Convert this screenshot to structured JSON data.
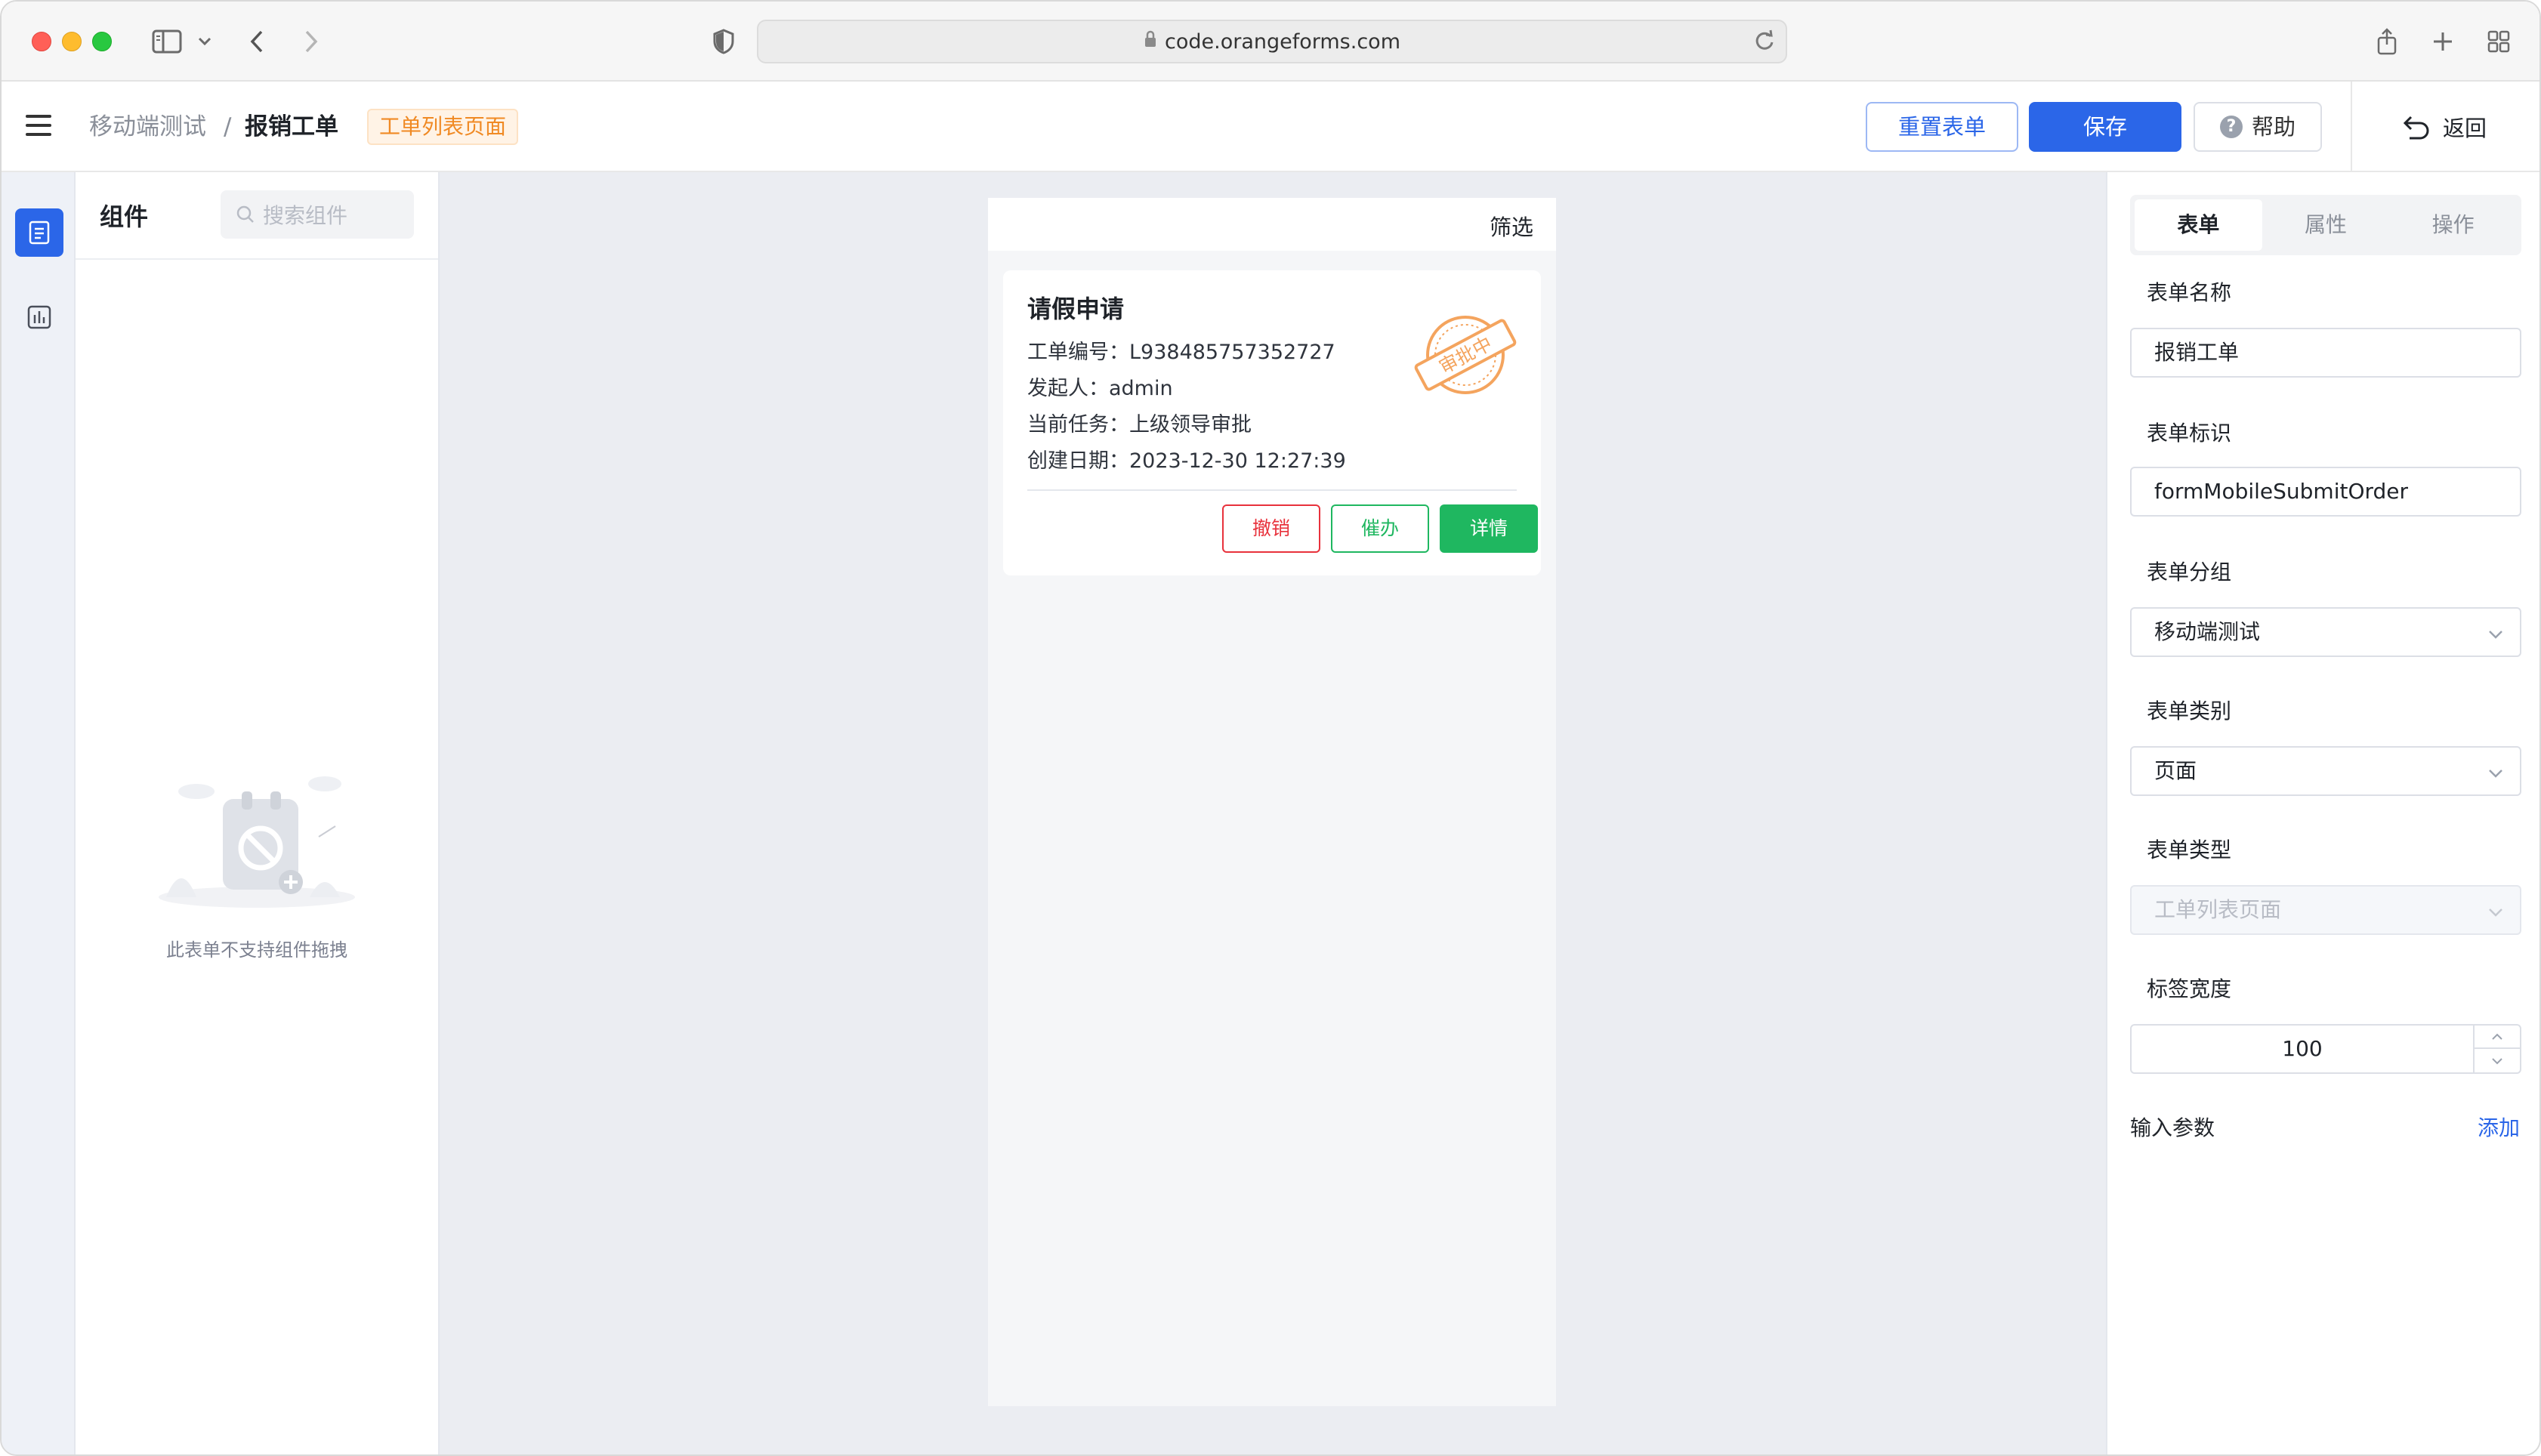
{
  "browser": {
    "url": "code.orangeforms.com"
  },
  "header": {
    "breadcrumb_parent": "移动端测试",
    "breadcrumb_separator": "/",
    "breadcrumb_current": "报销工单",
    "form_tag": "工单列表页面",
    "reset_label": "重置表单",
    "save_label": "保存",
    "help_label": "帮助",
    "back_label": "返回"
  },
  "components": {
    "title": "组件",
    "search_placeholder": "搜索组件",
    "empty_text": "此表单不支持组件拖拽"
  },
  "preview": {
    "filter_label": "筛选",
    "card": {
      "title": "请假申请",
      "order_no": "工单编号：L938485757352727",
      "initiator": "发起人：admin",
      "task": "当前任务：上级领导审批",
      "created": "创建日期：2023-12-30 12:27:39",
      "stamp_text": "审批中",
      "cancel_label": "撤销",
      "urge_label": "催办",
      "detail_label": "详情"
    }
  },
  "props": {
    "tabs": [
      {
        "label": "表单"
      },
      {
        "label": "属性"
      },
      {
        "label": "操作"
      }
    ],
    "form_name_label": "表单名称",
    "form_name_value": "报销工单",
    "form_id_label": "表单标识",
    "form_id_value": "formMobileSubmitOrder",
    "form_group_label": "表单分组",
    "form_group_value": "移动端测试",
    "form_category_label": "表单类别",
    "form_category_value": "页面",
    "form_type_label": "表单类型",
    "form_type_value": "工单列表页面",
    "label_width_label": "标签宽度",
    "label_width_value": "100",
    "params_label": "输入参数",
    "add_label": "添加"
  },
  "colors": {
    "primary": "#2b66e8",
    "success": "#1fb760",
    "danger": "#e8323c",
    "warning": "#f08a24"
  }
}
